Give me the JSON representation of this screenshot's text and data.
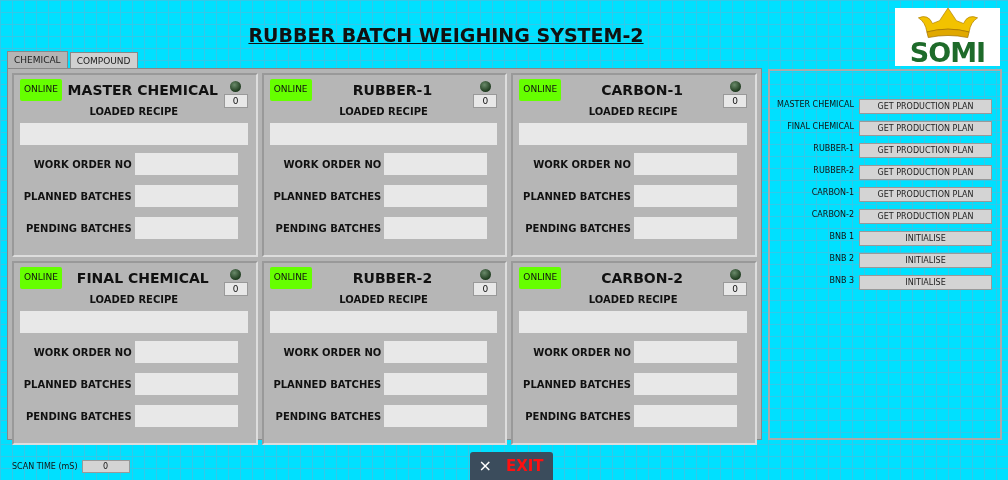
{
  "title": "RUBBER BATCH WEIGHING SYSTEM-2",
  "logo": {
    "text": "SOMI"
  },
  "tabs": [
    {
      "label": "CHEMICAL",
      "selected": true
    },
    {
      "label": "COMPOUND",
      "selected": false
    }
  ],
  "stations": [
    {
      "name": "MASTER CHEMICAL",
      "status": "ONLINE",
      "online": true,
      "led_on": false,
      "count": "0",
      "recipe_label": "LOADED RECIPE",
      "fields": [
        {
          "label": "WORK ORDER NO"
        },
        {
          "label": "PLANNED BATCHES"
        },
        {
          "label": "PENDING BATCHES"
        }
      ]
    },
    {
      "name": "RUBBER-1",
      "status": "ONLINE",
      "online": true,
      "led_on": false,
      "count": "0",
      "recipe_label": "LOADED RECIPE",
      "fields": [
        {
          "label": "WORK ORDER NO"
        },
        {
          "label": "PLANNED BATCHES"
        },
        {
          "label": "PENDING BATCHES"
        }
      ]
    },
    {
      "name": "CARBON-1",
      "status": "ONLINE",
      "online": true,
      "led_on": false,
      "count": "0",
      "recipe_label": "LOADED RECIPE",
      "fields": [
        {
          "label": "WORK ORDER NO"
        },
        {
          "label": "PLANNED BATCHES"
        },
        {
          "label": "PENDING BATCHES"
        }
      ]
    },
    {
      "name": "FINAL CHEMICAL",
      "status": "ONLINE",
      "online": true,
      "led_on": false,
      "count": "0",
      "recipe_label": "LOADED RECIPE",
      "fields": [
        {
          "label": "WORK ORDER NO"
        },
        {
          "label": "PLANNED BATCHES"
        },
        {
          "label": "PENDING BATCHES"
        }
      ]
    },
    {
      "name": "RUBBER-2",
      "status": "ONLINE",
      "online": true,
      "led_on": false,
      "count": "0",
      "recipe_label": "LOADED RECIPE",
      "fields": [
        {
          "label": "WORK ORDER NO"
        },
        {
          "label": "PLANNED BATCHES"
        },
        {
          "label": "PENDING BATCHES"
        }
      ]
    },
    {
      "name": "CARBON-2",
      "status": "ONLINE",
      "online": true,
      "led_on": false,
      "count": "0",
      "recipe_label": "LOADED RECIPE",
      "fields": [
        {
          "label": "WORK ORDER NO"
        },
        {
          "label": "PLANNED BATCHES"
        },
        {
          "label": "PENDING BATCHES"
        }
      ]
    }
  ],
  "actions": [
    {
      "label": "MASTER CHEMICAL",
      "button": "GET PRODUCTION PLAN"
    },
    {
      "label": "FINAL CHEMICAL",
      "button": "GET PRODUCTION PLAN"
    },
    {
      "label": "RUBBER-1",
      "button": "GET PRODUCTION PLAN"
    },
    {
      "label": "RUBBER-2",
      "button": "GET PRODUCTION PLAN"
    },
    {
      "label": "CARBON-1",
      "button": "GET PRODUCTION PLAN"
    },
    {
      "label": "CARBON-2",
      "button": "GET PRODUCTION PLAN"
    },
    {
      "label": "BNB 1",
      "button": "INITIALISE"
    },
    {
      "label": "BNB 2",
      "button": "INITIALISE"
    },
    {
      "label": "BNB 3",
      "button": "INITIALISE"
    }
  ],
  "scan_time": {
    "label": "SCAN TIME (mS)",
    "value": "0"
  },
  "exit_button": {
    "icon": "×",
    "label": "EXIT"
  }
}
